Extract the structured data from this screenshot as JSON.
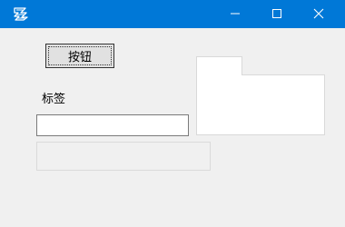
{
  "window": {
    "title_bar_color": "#0078d7",
    "icon": "app-icon",
    "controls": {
      "minimize": "minimize-icon",
      "maximize": "maximize-icon",
      "close": "close-icon"
    }
  },
  "form": {
    "button_label": "按钮",
    "label_text": "标签",
    "textbox_value": "",
    "disabled_box_value": ""
  },
  "tab_control": {
    "tabs": [
      ""
    ]
  }
}
